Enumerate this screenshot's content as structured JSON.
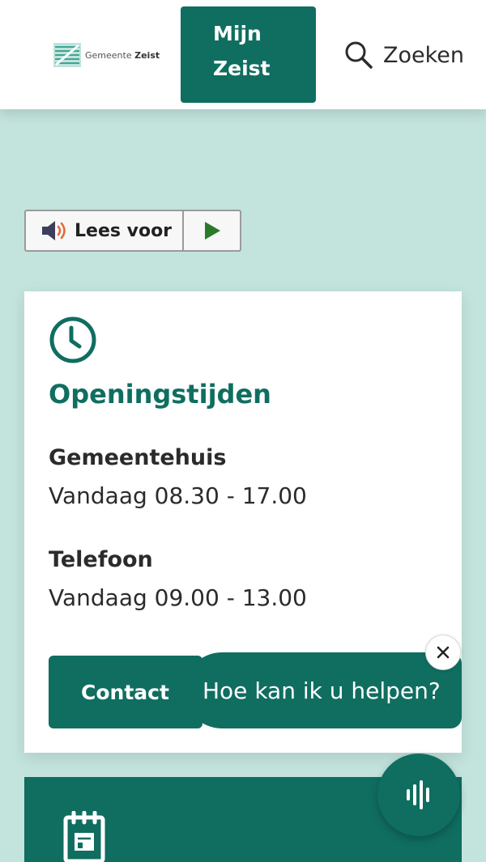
{
  "header": {
    "logo": {
      "text_regular": "Gemeente",
      "text_bold": "Zeist",
      "icon": "gemeente-zeist-logo"
    },
    "mijn_zeist": {
      "line1": "Mijn",
      "line2": "Zeist"
    },
    "search": {
      "label": "Zoeken",
      "icon": "search-icon"
    }
  },
  "readspeaker": {
    "label": "Lees voor",
    "icon": "speaker-icon",
    "play_icon": "play-icon"
  },
  "opening_hours": {
    "icon": "clock-icon",
    "title": "Openingstijden",
    "locations": [
      {
        "name": "Gemeentehuis",
        "hours": "Vandaag 08.30 - 17.00"
      },
      {
        "name": "Telefoon",
        "hours": "Vandaag 09.00 - 13.00"
      }
    ],
    "contact_label": "Contact"
  },
  "chat": {
    "prompt": "Hoe kan ik u helpen?",
    "close_icon": "close-icon"
  },
  "voice_assistant": {
    "icon": "voice-wave-icon"
  },
  "next_panel": {
    "icon": "calendar-icon"
  },
  "colors": {
    "brand_green": "#0f6e60",
    "page_background": "#c3e3dd",
    "speaker_accent": "#e0683a",
    "play_green": "#2a7a2a"
  }
}
